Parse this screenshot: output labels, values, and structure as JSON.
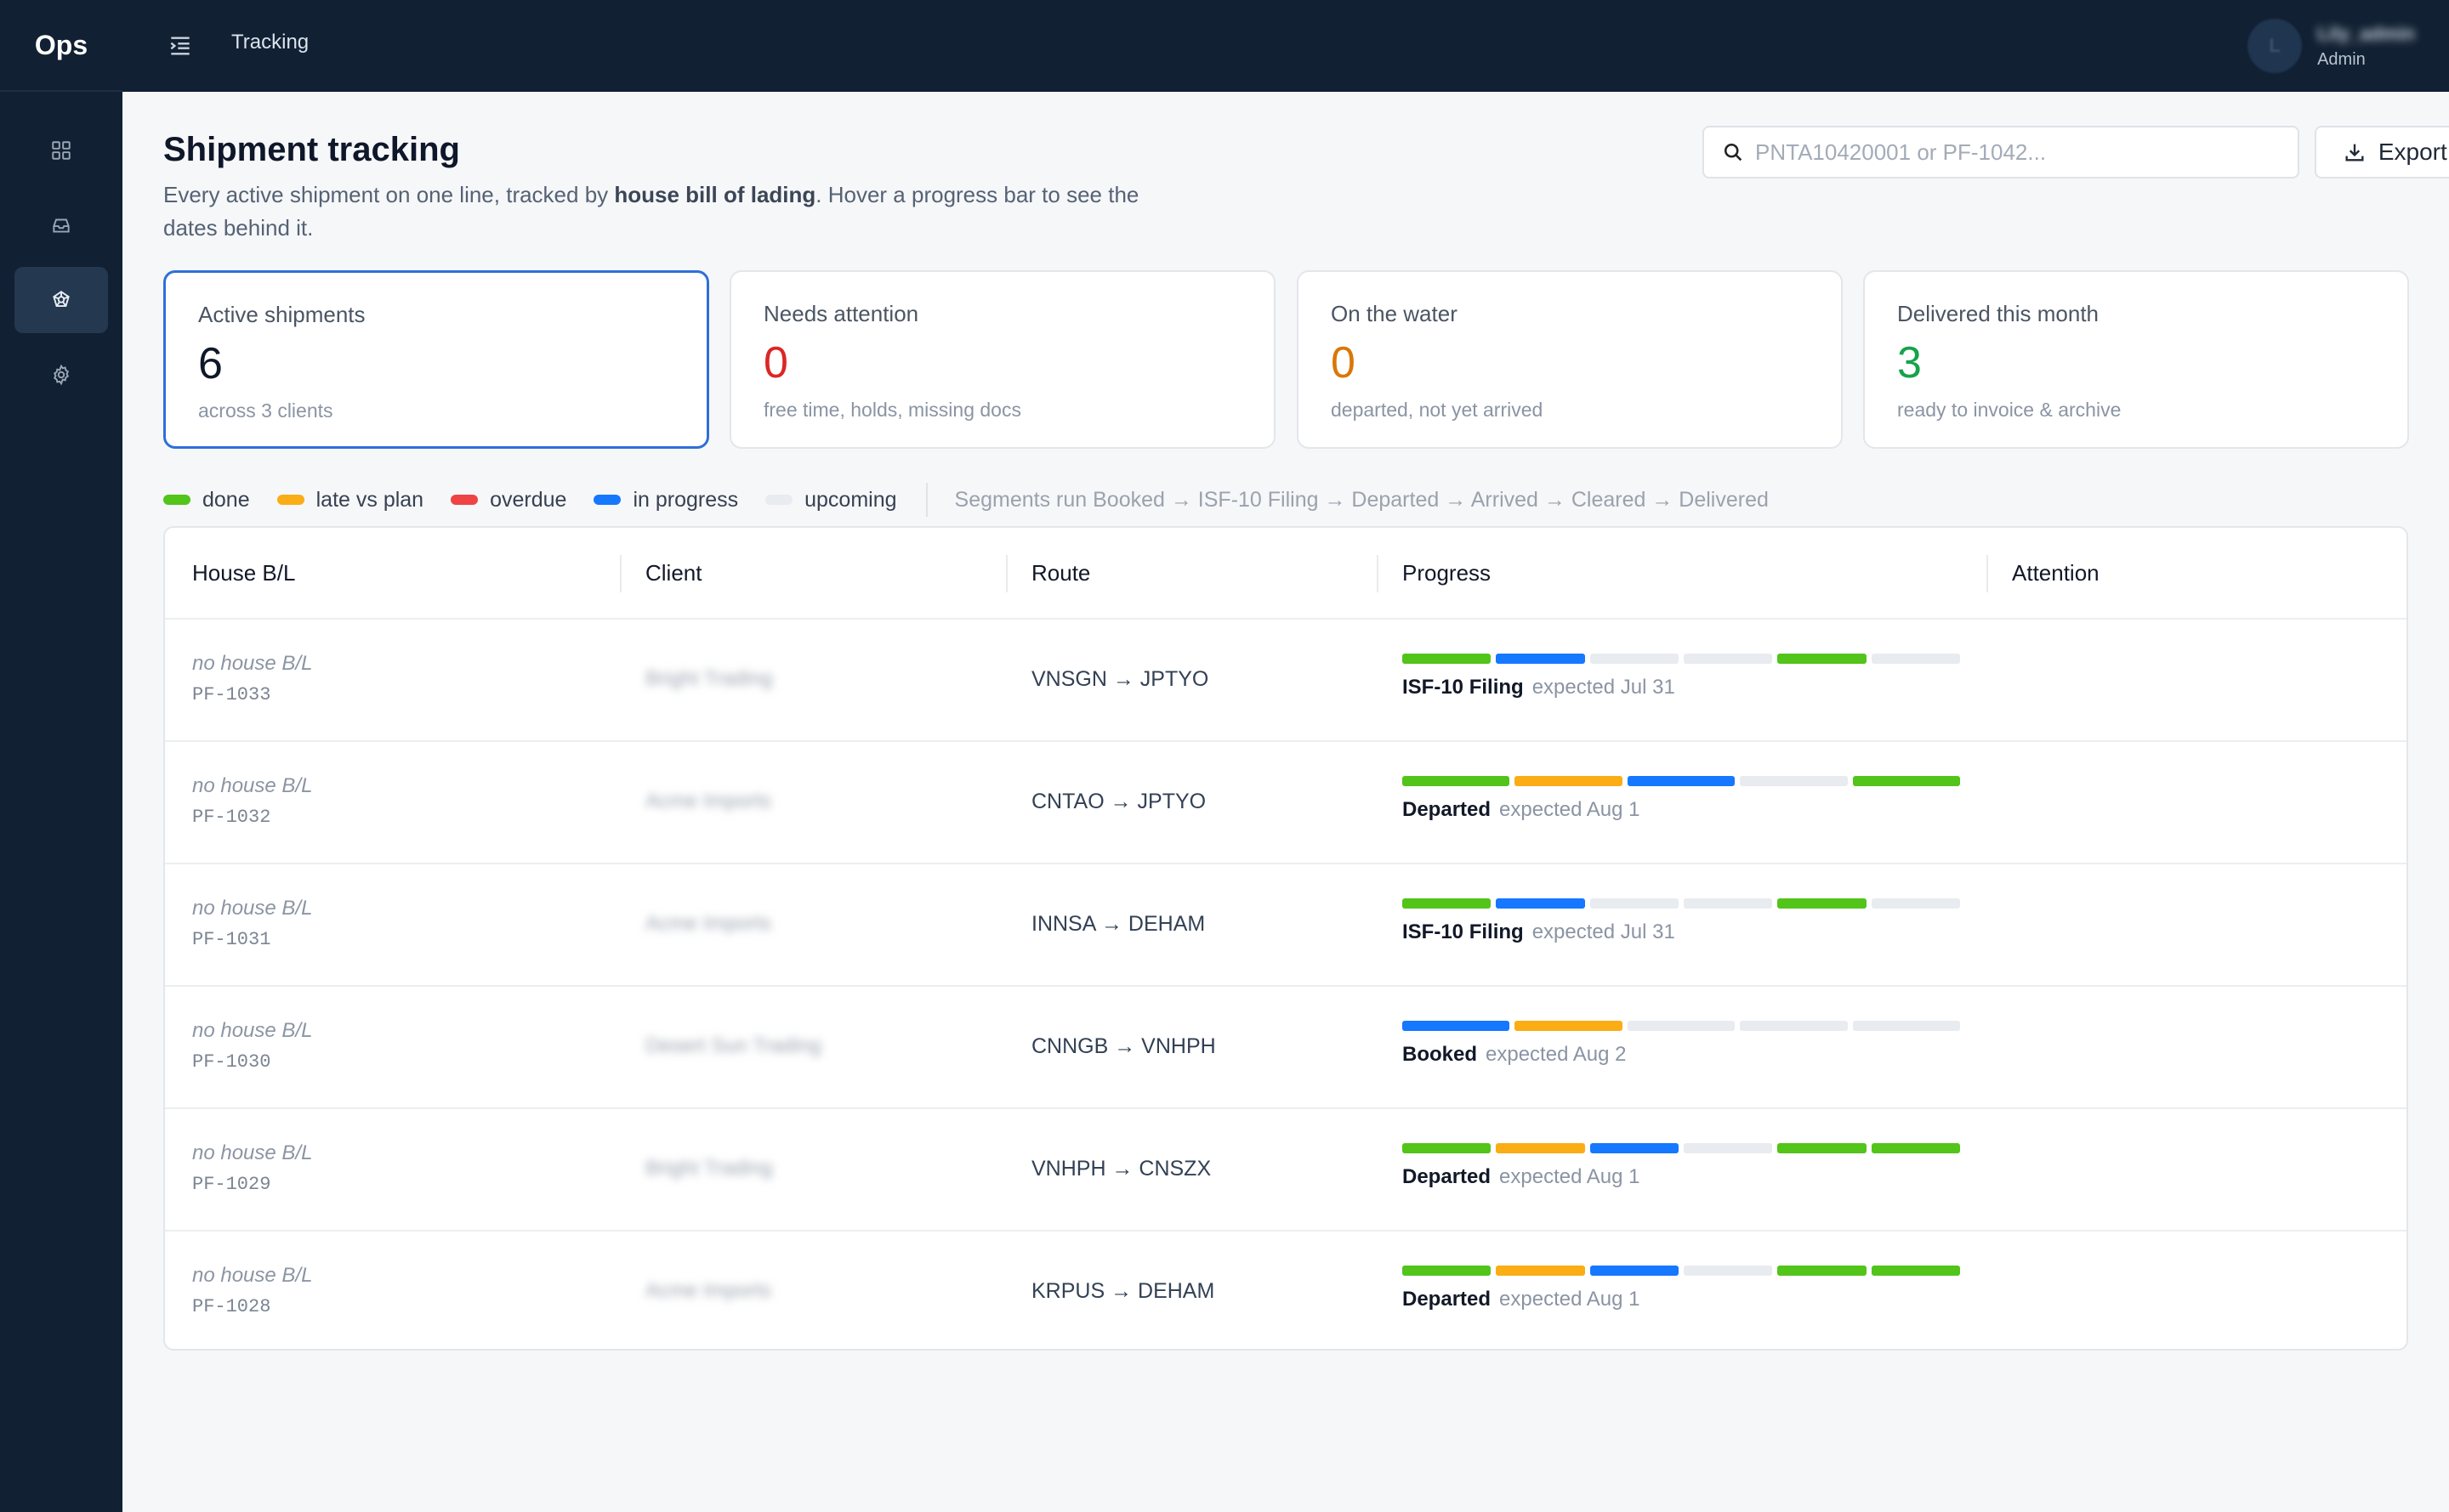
{
  "app": {
    "brand": "Ops"
  },
  "topbar": {
    "crumb": "Tracking",
    "user_initial": "L",
    "user_name": "Lily_admin",
    "user_role": "Admin"
  },
  "sidebar": {
    "items": [
      {
        "name": "dashboard",
        "icon": "grid-icon",
        "active": false
      },
      {
        "name": "inbox",
        "icon": "inbox-icon",
        "active": false
      },
      {
        "name": "tracking",
        "icon": "ship-wheel-icon",
        "active": true
      },
      {
        "name": "settings",
        "icon": "gear-icon",
        "active": false
      }
    ]
  },
  "page": {
    "title": "Shipment tracking",
    "desc_1": "Every active shipment on one line, tracked by ",
    "desc_bold": "house bill of lading",
    "desc_2": ". Hover a progress bar to see the dates behind it."
  },
  "search": {
    "placeholder": "PNTA10420001 or PF-1042..."
  },
  "export": {
    "label": "Export CSV"
  },
  "colors": {
    "done": "#52c41a",
    "late": "#faad14",
    "overdue": "#ef4444",
    "in_progress": "#1677ff",
    "upcoming": "#e8ebef"
  },
  "cards": [
    {
      "label": "Active shipments",
      "value": "6",
      "sub": "across 3 clients",
      "color": "#0f172a"
    },
    {
      "label": "Needs attention",
      "value": "0",
      "sub": "free time, holds, missing docs",
      "color": "#dc2626"
    },
    {
      "label": "On the water",
      "value": "0",
      "sub": "departed, not yet arrived",
      "color": "#d97706"
    },
    {
      "label": "Delivered this month",
      "value": "3",
      "sub": "ready to invoice & archive",
      "color": "#16a34a"
    }
  ],
  "legend": {
    "items": [
      {
        "label": "done",
        "key": "done"
      },
      {
        "label": "late vs plan",
        "key": "late"
      },
      {
        "label": "overdue",
        "key": "overdue"
      },
      {
        "label": "in progress",
        "key": "in_progress"
      },
      {
        "label": "upcoming",
        "key": "upcoming"
      }
    ],
    "flow": "Segments run Booked → ISF-10 Filing → Departed → Arrived → Cleared → Delivered"
  },
  "table": {
    "columns": [
      "House B/L",
      "Client",
      "Route",
      "Progress",
      "Attention"
    ],
    "rows": [
      {
        "hbl": "no house B/L",
        "ref": "PF-1033",
        "client": "Bright Trading",
        "route": "VNSGN → JPTYO",
        "stage": "ISF-10 Filing",
        "expected": "expected Jul 31",
        "segments": [
          "done",
          "in_progress",
          "upcoming",
          "upcoming",
          "done",
          "upcoming"
        ],
        "attention": ""
      },
      {
        "hbl": "no house B/L",
        "ref": "PF-1032",
        "client": "Acme Imports",
        "route": "CNTAO → JPTYO",
        "stage": "Departed",
        "expected": "expected Aug 1",
        "segments": [
          "done",
          "late",
          "in_progress",
          "upcoming",
          "done"
        ],
        "attention": ""
      },
      {
        "hbl": "no house B/L",
        "ref": "PF-1031",
        "client": "Acme Imports",
        "route": "INNSA → DEHAM",
        "stage": "ISF-10 Filing",
        "expected": "expected Jul 31",
        "segments": [
          "done",
          "in_progress",
          "upcoming",
          "upcoming",
          "done",
          "upcoming"
        ],
        "attention": ""
      },
      {
        "hbl": "no house B/L",
        "ref": "PF-1030",
        "client": "Desert Sun Trading",
        "route": "CNNGB → VNHPH",
        "stage": "Booked",
        "expected": "expected Aug 2",
        "segments": [
          "in_progress",
          "late",
          "upcoming",
          "upcoming",
          "upcoming"
        ],
        "attention": ""
      },
      {
        "hbl": "no house B/L",
        "ref": "PF-1029",
        "client": "Bright Trading",
        "route": "VNHPH → CNSZX",
        "stage": "Departed",
        "expected": "expected Aug 1",
        "segments": [
          "done",
          "late",
          "in_progress",
          "upcoming",
          "done",
          "done"
        ],
        "attention": ""
      },
      {
        "hbl": "no house B/L",
        "ref": "PF-1028",
        "client": "Acme Imports",
        "route": "KRPUS → DEHAM",
        "stage": "Departed",
        "expected": "expected Aug 1",
        "segments": [
          "done",
          "late",
          "in_progress",
          "upcoming",
          "done",
          "done"
        ],
        "attention": ""
      }
    ]
  }
}
